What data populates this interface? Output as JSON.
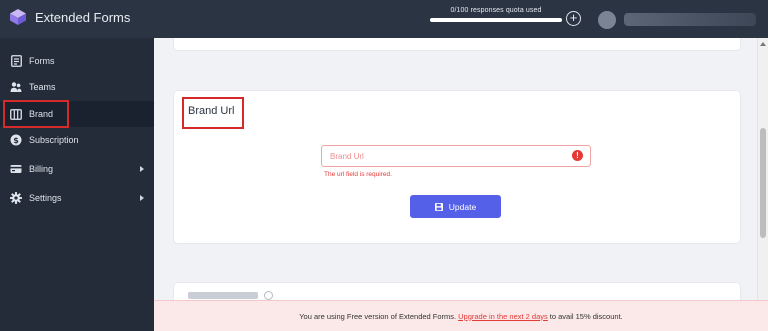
{
  "app": {
    "name": "Extended Forms"
  },
  "quota": {
    "text": "0/100 responses quota used",
    "used_fraction": 0.0
  },
  "sidebar": {
    "items": [
      {
        "label": "Forms",
        "icon": "forms-icon"
      },
      {
        "label": "Teams",
        "icon": "teams-icon"
      },
      {
        "label": "Brand",
        "icon": "brand-icon",
        "active": true
      },
      {
        "label": "Subscription",
        "icon": "dollar-icon"
      },
      {
        "label": "Billing",
        "icon": "billing-icon",
        "expandable": true
      },
      {
        "label": "Settings",
        "icon": "gear-icon",
        "expandable": true
      }
    ]
  },
  "brand_card": {
    "title": "Brand Url",
    "input": {
      "placeholder": "Brand Url",
      "value": ""
    },
    "error": "The url field is required.",
    "button_label": "Update"
  },
  "banner": {
    "prefix": "You are using Free version of Extended Forms.",
    "link": "Upgrade in the next 2 days",
    "suffix": "to avail 15% discount."
  },
  "colors": {
    "topbar": "#2a3442",
    "sidebar": "#232c38",
    "accent": "#5560e8",
    "error": "#e53935",
    "highlight": "#d42a2a"
  }
}
